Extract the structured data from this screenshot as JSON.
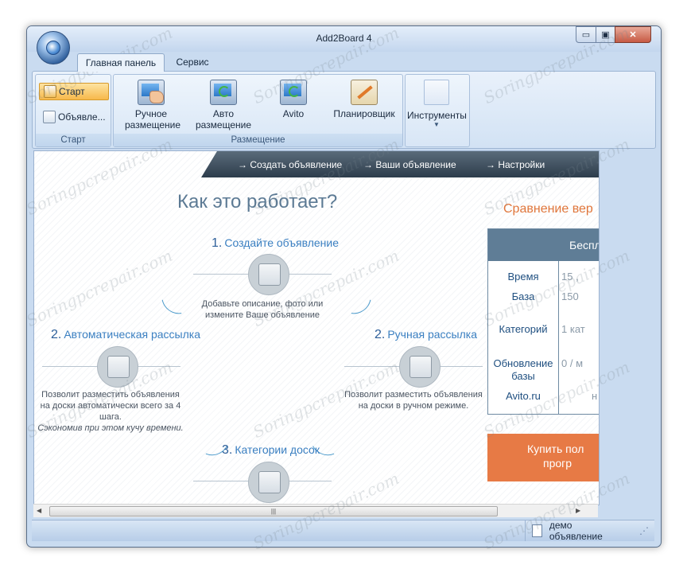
{
  "window": {
    "title": "Add2Board 4",
    "controls": {
      "minimize": "▭",
      "maximize": "▣",
      "close": "✕"
    }
  },
  "tabs": [
    {
      "label": "Главная панель",
      "active": true
    },
    {
      "label": "Сервис",
      "active": false
    }
  ],
  "ribbon": {
    "start_group": {
      "label": "Старт",
      "buttons": [
        {
          "label": "Старт",
          "icon": "start-icon"
        },
        {
          "label": "Объявле...",
          "icon": "ads-icon"
        }
      ]
    },
    "placement_group": {
      "label": "Размещение",
      "buttons": [
        {
          "line1": "Ручное",
          "line2": "размещение",
          "icon": "manual-placement-icon"
        },
        {
          "line1": "Авто",
          "line2": "размещение",
          "icon": "auto-placement-icon"
        },
        {
          "line1": "Avito",
          "line2": "",
          "icon": "avito-icon"
        },
        {
          "line1": "Планировщик",
          "line2": "",
          "icon": "planner-icon"
        }
      ]
    },
    "tools": {
      "label": "Инструменты",
      "arrow": "▼"
    }
  },
  "nav": {
    "items": [
      "Создать объявление",
      "Ваши объявление",
      "Настройки"
    ],
    "arrow": "→"
  },
  "how": {
    "title": "Как это работает?",
    "step1": {
      "num": "1.",
      "label": "Создайте объявление",
      "desc_line1": "Добавьте описание, фото или",
      "desc_line2": "измените Ваше объявление"
    },
    "step2a": {
      "num": "2.",
      "label": "Автоматическая рассылка",
      "desc_line1": "Позволит разместить объявления",
      "desc_line2": "на доски автоматически всего за 4",
      "desc_line3": "шага.",
      "desc_italic": "Сэкономив при этом кучу времени."
    },
    "step2b": {
      "num": "2.",
      "label": "Ручная рассылка",
      "desc_line1": "Позволит разместить объявления",
      "desc_line2": "на доски в ручном режиме."
    },
    "step3": {
      "num": "3.",
      "label": "Категории досок"
    }
  },
  "compare": {
    "title": "Сравнение вер",
    "header": "Беспл",
    "rows": [
      {
        "label": "Время",
        "value": "15 ,"
      },
      {
        "label": "База",
        "value": "150"
      },
      {
        "label": "Категорий",
        "value": "1 кат"
      },
      {
        "label_line1": "Обновление",
        "label_line2": "базы",
        "value": "0 / м"
      },
      {
        "label": "Avito.ru",
        "value": "н"
      }
    ],
    "buy_line1": "Купить пол",
    "buy_line2": "прогр"
  },
  "scroll": {
    "up": "▲",
    "down": "▼",
    "left": "◀",
    "right": "▶",
    "grip": "|||",
    "vgrip": "≡"
  },
  "status": {
    "text": "демо объявление",
    "grip": "⋰"
  },
  "watermark": "Soringpcrepair.com"
}
